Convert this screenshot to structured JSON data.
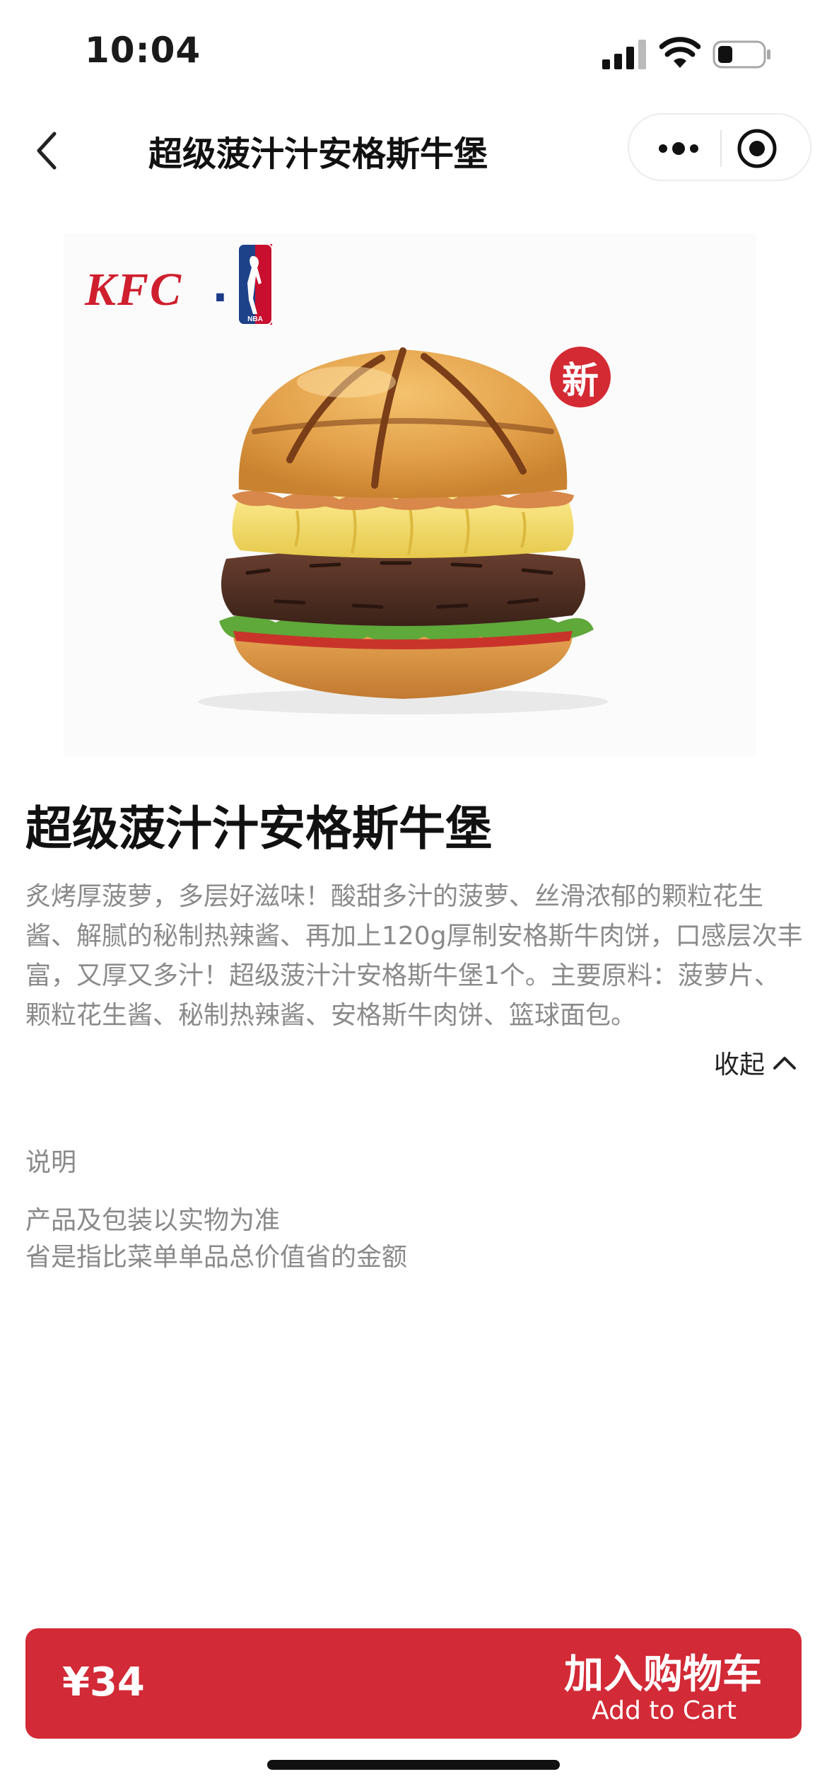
{
  "status_bar": {
    "time": "10:04",
    "icons": [
      "signal-icon",
      "wifi-icon",
      "battery-icon"
    ]
  },
  "nav": {
    "title": "超级菠汁汁安格斯牛堡",
    "icons": [
      "back-arrow-icon",
      "more-dots-icon",
      "close-miniprogram-icon"
    ]
  },
  "hero": {
    "brand_logo": "KFC",
    "partner_logo": "NBA",
    "badge": "新"
  },
  "product": {
    "title": "超级菠汁汁安格斯牛堡",
    "description": "炙烤厚菠萝，多层好滋味！酸甜多汁的菠萝、丝滑浓郁的颗粒花生酱、解腻的秘制热辣酱、再加上120g厚制安格斯牛肉饼，口感层次丰富，又厚又多汁！超级菠汁汁安格斯牛堡1个。主要原料：菠萝片、颗粒花生酱、秘制热辣酱、安格斯牛肉饼、篮球面包。",
    "collapse_label": "收起"
  },
  "notes": {
    "label": "说明",
    "lines": [
      "产品及包装以实物为准",
      "省是指比菜单单品总价值省的金额"
    ]
  },
  "cart": {
    "price": "¥34",
    "button_cn": "加入购物车",
    "button_en": "Add to Cart"
  },
  "colors": {
    "accent": "#d22a36",
    "kfc_red": "#cf1f2e",
    "muted_text": "#8a8a8a"
  }
}
